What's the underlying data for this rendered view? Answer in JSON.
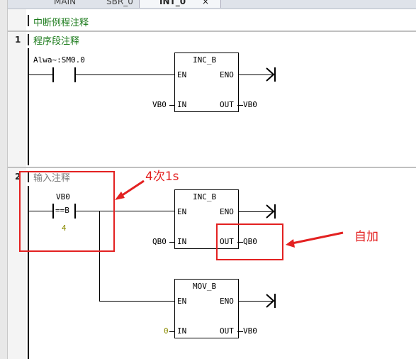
{
  "tabs": [
    {
      "label": "MAIN"
    },
    {
      "label": "SBR_0"
    },
    {
      "label": "INT_0"
    }
  ],
  "tab_close_glyph": "×",
  "program_comment": "中断例程注释",
  "rungs": [
    {
      "number": "1",
      "comment": "程序段注释",
      "contact_label": "Alwa~:SM0.0",
      "blocks": [
        {
          "title": "INC_B",
          "en": "EN",
          "eno": "ENO",
          "in_pin": "IN",
          "out_pin": "OUT",
          "in_operand": "VB0",
          "out_operand": "VB0"
        }
      ]
    },
    {
      "number": "2",
      "comment": "输入注释",
      "compare": {
        "operand_top": "VB0",
        "operator": "==B",
        "operand_bottom": "4"
      },
      "blocks": [
        {
          "title": "INC_B",
          "en": "EN",
          "eno": "ENO",
          "in_pin": "IN",
          "out_pin": "OUT",
          "in_operand": "QB0",
          "out_operand": "QB0"
        },
        {
          "title": "MOV_B",
          "en": "EN",
          "eno": "ENO",
          "in_pin": "IN",
          "out_pin": "OUT",
          "in_operand": "0",
          "out_operand": "VB0"
        }
      ]
    }
  ],
  "annotations": {
    "compare_note": "4次1s",
    "increment_note": "自加"
  },
  "colors": {
    "comment_green": "#1a7a1a",
    "annotation_red": "#e32121",
    "constant_olive": "#8b8b00"
  }
}
